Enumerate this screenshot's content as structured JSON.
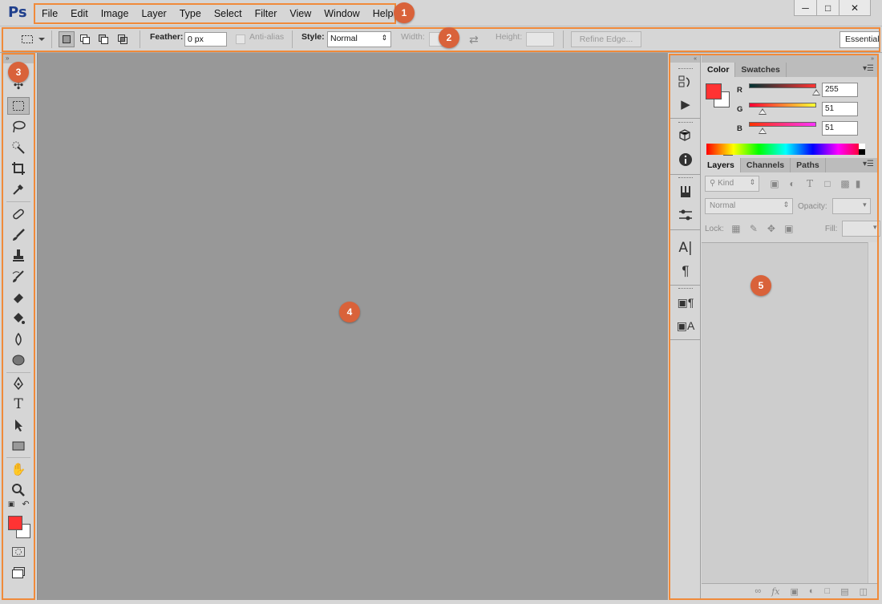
{
  "app": {
    "logo_text": "Ps"
  },
  "menu": {
    "items": [
      "File",
      "Edit",
      "Image",
      "Layer",
      "Type",
      "Select",
      "Filter",
      "View",
      "Window",
      "Help"
    ]
  },
  "window_controls": {
    "minimize": "minimize-icon",
    "maximize": "maximize-icon",
    "close": "close-icon"
  },
  "callouts": [
    "1",
    "2",
    "3",
    "4",
    "5"
  ],
  "options_bar": {
    "feather_label": "Feather:",
    "feather_value": "0 px",
    "antialias_label": "Anti-alias",
    "style_label": "Style:",
    "style_value": "Normal",
    "width_label": "Width:",
    "height_label": "Height:",
    "refine_edge": "Refine Edge...",
    "workspace": "Essentials"
  },
  "color_panel": {
    "tabs": [
      "Color",
      "Swatches"
    ],
    "foreground": "#ff3333",
    "background": "#ffffff",
    "channels": [
      {
        "label": "R",
        "value": "255",
        "fraction": 1.0
      },
      {
        "label": "G",
        "value": "51",
        "fraction": 0.2
      },
      {
        "label": "B",
        "value": "51",
        "fraction": 0.2
      }
    ]
  },
  "layers_panel": {
    "tabs": [
      "Layers",
      "Channels",
      "Paths"
    ],
    "filter_kind": "Kind",
    "blend_mode": "Normal",
    "opacity_label": "Opacity:",
    "lock_label": "Lock:",
    "fill_label": "Fill:"
  },
  "toolbox": {
    "foreground": "#ff3333",
    "background": "#ffffff"
  },
  "colors": {
    "accent": "#f08a3a",
    "callout": "#d9623a",
    "canvas": "#989898"
  }
}
